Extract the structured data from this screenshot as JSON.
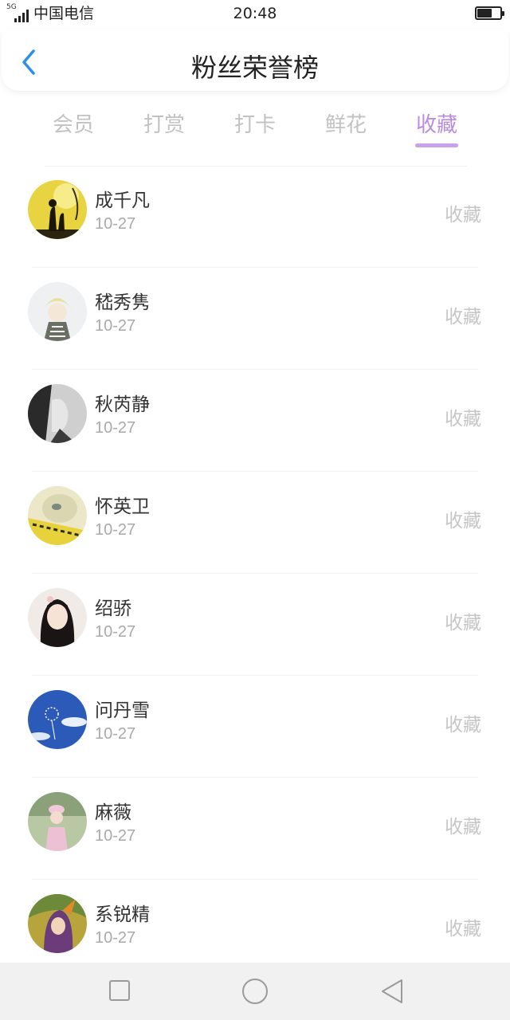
{
  "status": {
    "network": "5G",
    "carrier": "中国电信",
    "time": "20:48",
    "battery_level": 0.65
  },
  "header": {
    "title": "粉丝荣誉榜",
    "back_icon": "chevron-left-icon",
    "accent_color": "#2b8ff0"
  },
  "tabs": [
    {
      "label": "会员",
      "active": false
    },
    {
      "label": "打赏",
      "active": false
    },
    {
      "label": "打卡",
      "active": false
    },
    {
      "label": "鲜花",
      "active": false
    },
    {
      "label": "收藏",
      "active": true
    }
  ],
  "active_tab_color": "#b98ce0",
  "list": {
    "items": [
      {
        "name": "成千凡",
        "date": "10-27",
        "label": "收藏"
      },
      {
        "name": "嵇秀隽",
        "date": "10-27",
        "label": "收藏"
      },
      {
        "name": "秋芮静",
        "date": "10-27",
        "label": "收藏"
      },
      {
        "name": "怀英卫",
        "date": "10-27",
        "label": "收藏"
      },
      {
        "name": "绍骄",
        "date": "10-27",
        "label": "收藏"
      },
      {
        "name": "问丹雪",
        "date": "10-27",
        "label": "收藏"
      },
      {
        "name": "麻薇",
        "date": "10-27",
        "label": "收藏"
      },
      {
        "name": "系锐精",
        "date": "10-27",
        "label": "收藏"
      }
    ]
  },
  "nav": {
    "square_icon": "square-icon",
    "home_icon": "circle-icon",
    "back_icon": "triangle-back-icon"
  }
}
